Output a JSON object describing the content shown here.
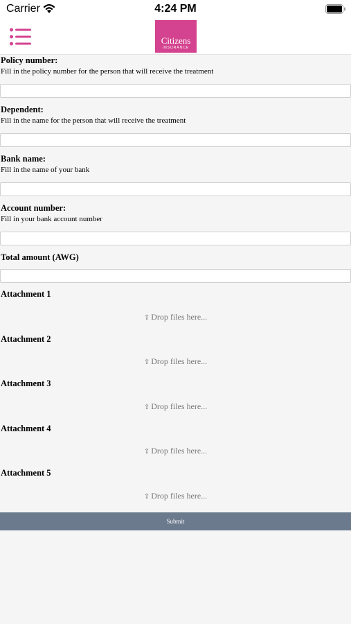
{
  "status_bar": {
    "carrier": "Carrier",
    "time": "4:24 PM"
  },
  "header": {
    "logo_name": "Citizens",
    "logo_sub": "INSURANCE",
    "brand_color": "#d4438f"
  },
  "form": {
    "policy_label": "Policy number:",
    "policy_help": "Fill in the policy number for the person that will receive the treatment",
    "policy_value": "",
    "dependent_label": "Dependent:",
    "dependent_help": "Fill in the name for the person that will receive the treatment",
    "dependent_value": "",
    "bank_label": "Bank name:",
    "bank_help": "Fill in the name of your bank",
    "bank_value": "",
    "account_label": "Account number:",
    "account_help": "Fill in your bank account number",
    "account_value": "",
    "total_label": "Total amount (AWG)",
    "total_value": "",
    "attachments": [
      {
        "label": "Attachment 1",
        "drop_text": "Drop files here..."
      },
      {
        "label": "Attachment 2",
        "drop_text": "Drop files here..."
      },
      {
        "label": "Attachment 3",
        "drop_text": "Drop files here..."
      },
      {
        "label": "Attachment 4",
        "drop_text": "Drop files here..."
      },
      {
        "label": "Attachment 5",
        "drop_text": "Drop files here..."
      }
    ],
    "submit_label": "Submit"
  }
}
